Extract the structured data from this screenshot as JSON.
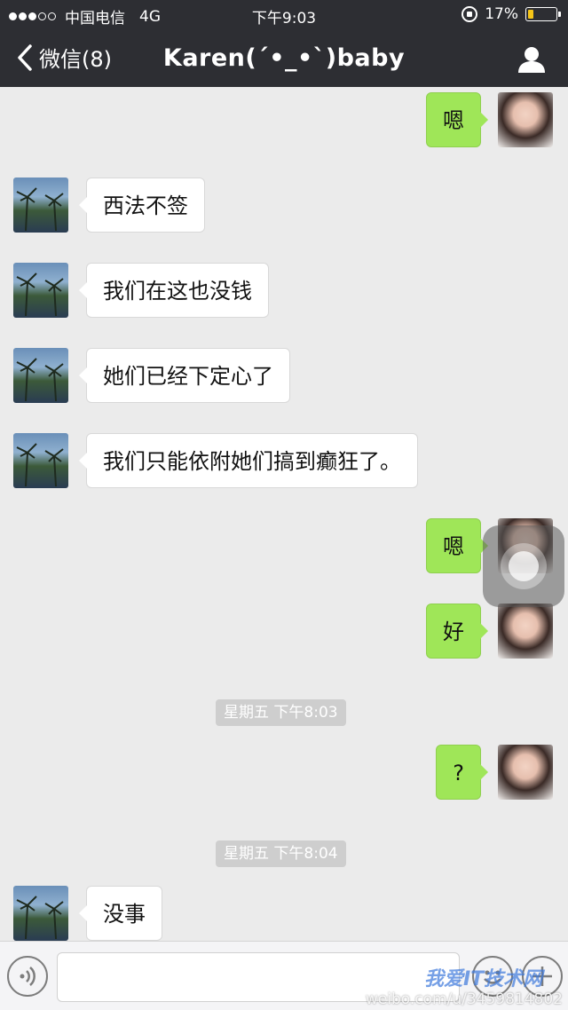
{
  "status_bar": {
    "carrier": "中国电信",
    "network": "4G",
    "time": "下午9:03",
    "battery": "17%"
  },
  "nav": {
    "back_label": "微信(8)",
    "title": "Karen(´•_•`)baby"
  },
  "messages": [
    {
      "side": "out",
      "text": "嗯"
    },
    {
      "side": "in",
      "text": "西法不签"
    },
    {
      "side": "in",
      "text": "我们在这也没钱"
    },
    {
      "side": "in",
      "text": "她们已经下定心了"
    },
    {
      "side": "in",
      "text": "我们只能依附她们搞到癫狂了。"
    },
    {
      "side": "out",
      "text": "嗯"
    },
    {
      "side": "out",
      "text": "好"
    },
    {
      "type": "time",
      "text": "星期五 下午8:03"
    },
    {
      "side": "out",
      "text": "?"
    },
    {
      "type": "time",
      "text": "星期五 下午8:04"
    },
    {
      "side": "in",
      "text": "没事"
    }
  ],
  "watermark": {
    "site": "weibo.com/u/3459814802",
    "logo_text": "我爱IT技术网"
  },
  "colors": {
    "topbar": "#2d2e33",
    "background": "#ebebeb",
    "outgoing_bubble": "#9fe658",
    "incoming_bubble": "#ffffff"
  }
}
